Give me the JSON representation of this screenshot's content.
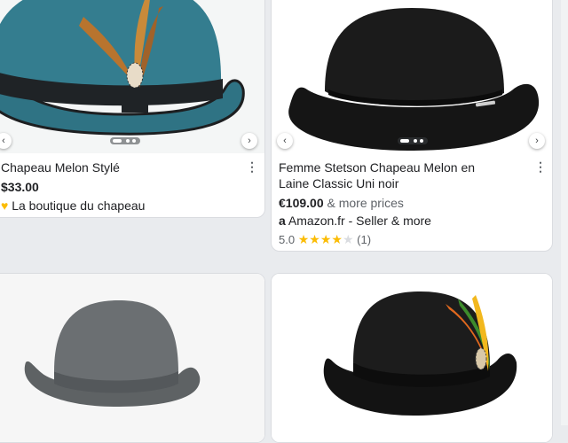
{
  "colors": {
    "page_bg": "#e9ebee",
    "star": "#fbbc04"
  },
  "top_overflow": "...",
  "products": [
    {
      "title": "Chapeau Melon Stylé",
      "price": "$33.00",
      "seller": "La boutique du chapeau",
      "image_icon": "teal-bowler-hat-with-feather"
    },
    {
      "title_line1": "Femme Stetson Chapeau Melon en",
      "title_line2": "Laine Classic Uni noir",
      "price": "€109.00",
      "price_extra": "& more prices",
      "seller": "Amazon.fr - Seller & more",
      "seller_icon": "amazon-icon",
      "rating_value": "5.0",
      "rating_count": "(1)",
      "stars_filled": 4,
      "stars_total": 5,
      "image_icon": "black-bowler-hat"
    },
    {
      "image_icon": "grey-bowler-hat"
    },
    {
      "image_icon": "black-bowler-hat-with-feather"
    }
  ]
}
